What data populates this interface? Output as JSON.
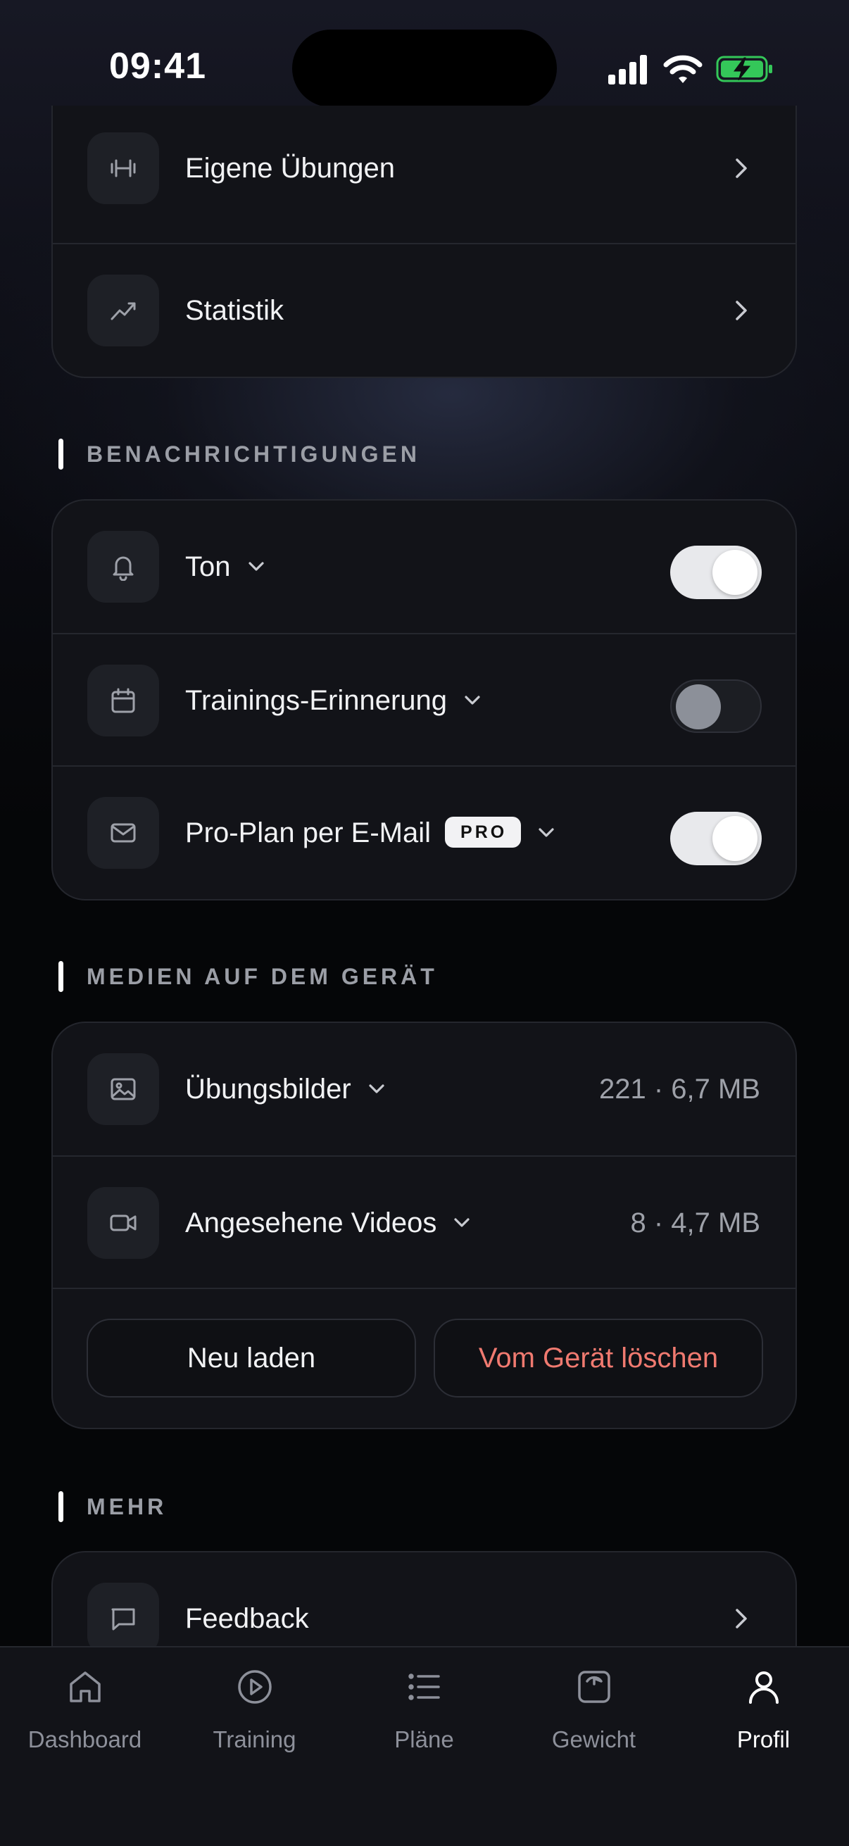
{
  "status_bar": {
    "time": "09:41"
  },
  "top_card": {
    "items": [
      {
        "label": "Eigene Übungen",
        "icon": "dumbbell-icon"
      },
      {
        "label": "Statistik",
        "icon": "trend-icon"
      }
    ]
  },
  "notifications": {
    "title": "BENACHRICHTIGUNGEN",
    "items": [
      {
        "label": "Ton",
        "icon": "bell-icon",
        "enabled": true
      },
      {
        "label": "Trainings-Erinnerung",
        "icon": "calendar-icon",
        "enabled": false
      },
      {
        "label": "Pro-Plan per E-Mail",
        "icon": "mail-icon",
        "badge": "PRO",
        "enabled": true
      }
    ]
  },
  "media": {
    "title": "MEDIEN AUF DEM GERÄT",
    "items": [
      {
        "label": "Übungsbilder",
        "icon": "image-icon",
        "value": "221 · 6,7 MB"
      },
      {
        "label": "Angesehene Videos",
        "icon": "video-icon",
        "value": "8 · 4,7 MB"
      }
    ],
    "reload_label": "Neu laden",
    "delete_label": "Vom Gerät löschen"
  },
  "more": {
    "title": "MEHR",
    "items": [
      {
        "label": "Feedback",
        "icon": "chat-icon"
      }
    ]
  },
  "tab_bar": {
    "active": "Profil",
    "tabs": [
      {
        "label": "Dashboard",
        "icon": "home-icon"
      },
      {
        "label": "Training",
        "icon": "play-circle-icon"
      },
      {
        "label": "Pläne",
        "icon": "list-icon"
      },
      {
        "label": "Gewicht",
        "icon": "scale-icon"
      },
      {
        "label": "Profil",
        "icon": "user-icon"
      }
    ]
  },
  "colors": {
    "background": "#050608",
    "card": "#121318",
    "accent_delete": "#f07a70",
    "battery_green": "#34c759"
  }
}
